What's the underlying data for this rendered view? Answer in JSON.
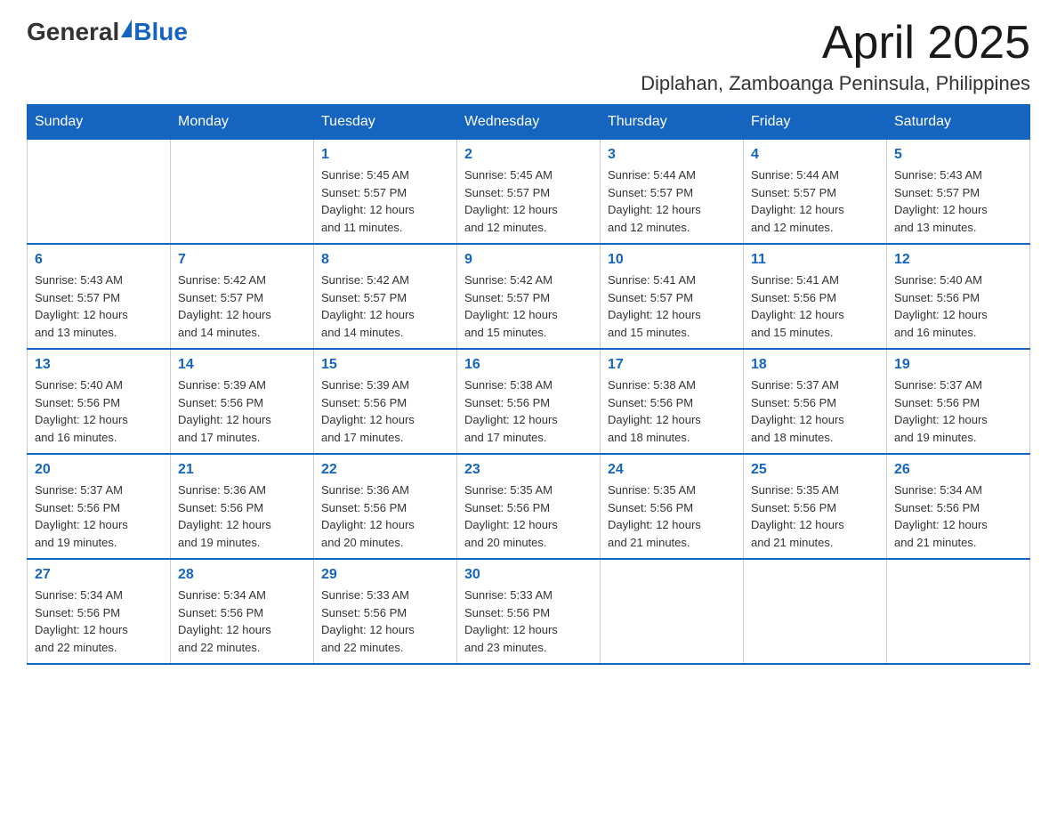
{
  "logo": {
    "general": "General",
    "blue": "Blue"
  },
  "title": "April 2025",
  "subtitle": "Diplahan, Zamboanga Peninsula, Philippines",
  "weekdays": [
    "Sunday",
    "Monday",
    "Tuesday",
    "Wednesday",
    "Thursday",
    "Friday",
    "Saturday"
  ],
  "weeks": [
    [
      {
        "day": "",
        "info": ""
      },
      {
        "day": "",
        "info": ""
      },
      {
        "day": "1",
        "info": "Sunrise: 5:45 AM\nSunset: 5:57 PM\nDaylight: 12 hours\nand 11 minutes."
      },
      {
        "day": "2",
        "info": "Sunrise: 5:45 AM\nSunset: 5:57 PM\nDaylight: 12 hours\nand 12 minutes."
      },
      {
        "day": "3",
        "info": "Sunrise: 5:44 AM\nSunset: 5:57 PM\nDaylight: 12 hours\nand 12 minutes."
      },
      {
        "day": "4",
        "info": "Sunrise: 5:44 AM\nSunset: 5:57 PM\nDaylight: 12 hours\nand 12 minutes."
      },
      {
        "day": "5",
        "info": "Sunrise: 5:43 AM\nSunset: 5:57 PM\nDaylight: 12 hours\nand 13 minutes."
      }
    ],
    [
      {
        "day": "6",
        "info": "Sunrise: 5:43 AM\nSunset: 5:57 PM\nDaylight: 12 hours\nand 13 minutes."
      },
      {
        "day": "7",
        "info": "Sunrise: 5:42 AM\nSunset: 5:57 PM\nDaylight: 12 hours\nand 14 minutes."
      },
      {
        "day": "8",
        "info": "Sunrise: 5:42 AM\nSunset: 5:57 PM\nDaylight: 12 hours\nand 14 minutes."
      },
      {
        "day": "9",
        "info": "Sunrise: 5:42 AM\nSunset: 5:57 PM\nDaylight: 12 hours\nand 15 minutes."
      },
      {
        "day": "10",
        "info": "Sunrise: 5:41 AM\nSunset: 5:57 PM\nDaylight: 12 hours\nand 15 minutes."
      },
      {
        "day": "11",
        "info": "Sunrise: 5:41 AM\nSunset: 5:56 PM\nDaylight: 12 hours\nand 15 minutes."
      },
      {
        "day": "12",
        "info": "Sunrise: 5:40 AM\nSunset: 5:56 PM\nDaylight: 12 hours\nand 16 minutes."
      }
    ],
    [
      {
        "day": "13",
        "info": "Sunrise: 5:40 AM\nSunset: 5:56 PM\nDaylight: 12 hours\nand 16 minutes."
      },
      {
        "day": "14",
        "info": "Sunrise: 5:39 AM\nSunset: 5:56 PM\nDaylight: 12 hours\nand 17 minutes."
      },
      {
        "day": "15",
        "info": "Sunrise: 5:39 AM\nSunset: 5:56 PM\nDaylight: 12 hours\nand 17 minutes."
      },
      {
        "day": "16",
        "info": "Sunrise: 5:38 AM\nSunset: 5:56 PM\nDaylight: 12 hours\nand 17 minutes."
      },
      {
        "day": "17",
        "info": "Sunrise: 5:38 AM\nSunset: 5:56 PM\nDaylight: 12 hours\nand 18 minutes."
      },
      {
        "day": "18",
        "info": "Sunrise: 5:37 AM\nSunset: 5:56 PM\nDaylight: 12 hours\nand 18 minutes."
      },
      {
        "day": "19",
        "info": "Sunrise: 5:37 AM\nSunset: 5:56 PM\nDaylight: 12 hours\nand 19 minutes."
      }
    ],
    [
      {
        "day": "20",
        "info": "Sunrise: 5:37 AM\nSunset: 5:56 PM\nDaylight: 12 hours\nand 19 minutes."
      },
      {
        "day": "21",
        "info": "Sunrise: 5:36 AM\nSunset: 5:56 PM\nDaylight: 12 hours\nand 19 minutes."
      },
      {
        "day": "22",
        "info": "Sunrise: 5:36 AM\nSunset: 5:56 PM\nDaylight: 12 hours\nand 20 minutes."
      },
      {
        "day": "23",
        "info": "Sunrise: 5:35 AM\nSunset: 5:56 PM\nDaylight: 12 hours\nand 20 minutes."
      },
      {
        "day": "24",
        "info": "Sunrise: 5:35 AM\nSunset: 5:56 PM\nDaylight: 12 hours\nand 21 minutes."
      },
      {
        "day": "25",
        "info": "Sunrise: 5:35 AM\nSunset: 5:56 PM\nDaylight: 12 hours\nand 21 minutes."
      },
      {
        "day": "26",
        "info": "Sunrise: 5:34 AM\nSunset: 5:56 PM\nDaylight: 12 hours\nand 21 minutes."
      }
    ],
    [
      {
        "day": "27",
        "info": "Sunrise: 5:34 AM\nSunset: 5:56 PM\nDaylight: 12 hours\nand 22 minutes."
      },
      {
        "day": "28",
        "info": "Sunrise: 5:34 AM\nSunset: 5:56 PM\nDaylight: 12 hours\nand 22 minutes."
      },
      {
        "day": "29",
        "info": "Sunrise: 5:33 AM\nSunset: 5:56 PM\nDaylight: 12 hours\nand 22 minutes."
      },
      {
        "day": "30",
        "info": "Sunrise: 5:33 AM\nSunset: 5:56 PM\nDaylight: 12 hours\nand 23 minutes."
      },
      {
        "day": "",
        "info": ""
      },
      {
        "day": "",
        "info": ""
      },
      {
        "day": "",
        "info": ""
      }
    ]
  ]
}
